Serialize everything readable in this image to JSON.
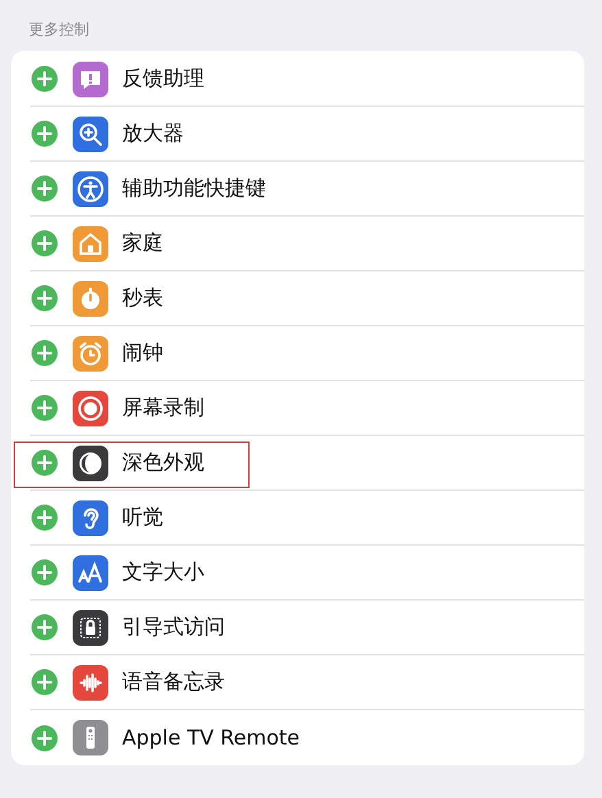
{
  "section_header": "更多控制",
  "controls": [
    {
      "label": "反馈助理",
      "kind": "feedback",
      "color": "#b36bd0",
      "highlighted": false
    },
    {
      "label": "放大器",
      "kind": "magnifier",
      "color": "#2f6fe0",
      "highlighted": false
    },
    {
      "label": "辅助功能快捷键",
      "kind": "accessibility",
      "color": "#2f6fe0",
      "highlighted": false
    },
    {
      "label": "家庭",
      "kind": "home",
      "color": "#f09a37",
      "highlighted": false
    },
    {
      "label": "秒表",
      "kind": "stopwatch",
      "color": "#f09a37",
      "highlighted": false
    },
    {
      "label": "闹钟",
      "kind": "alarm",
      "color": "#f09a37",
      "highlighted": false
    },
    {
      "label": "屏幕录制",
      "kind": "record",
      "color": "#e5473d",
      "highlighted": false
    },
    {
      "label": "深色外观",
      "kind": "dark",
      "color": "#3a3a3c",
      "highlighted": true
    },
    {
      "label": "听觉",
      "kind": "ear",
      "color": "#2f6fe0",
      "highlighted": false
    },
    {
      "label": "文字大小",
      "kind": "textsize",
      "color": "#2f6fe0",
      "highlighted": false
    },
    {
      "label": "引导式访问",
      "kind": "lock",
      "color": "#3a3a3c",
      "highlighted": false
    },
    {
      "label": "语音备忘录",
      "kind": "voice",
      "color": "#e5473d",
      "highlighted": false
    },
    {
      "label": "Apple TV Remote",
      "kind": "remote",
      "color": "#8e8e93",
      "highlighted": false
    }
  ]
}
